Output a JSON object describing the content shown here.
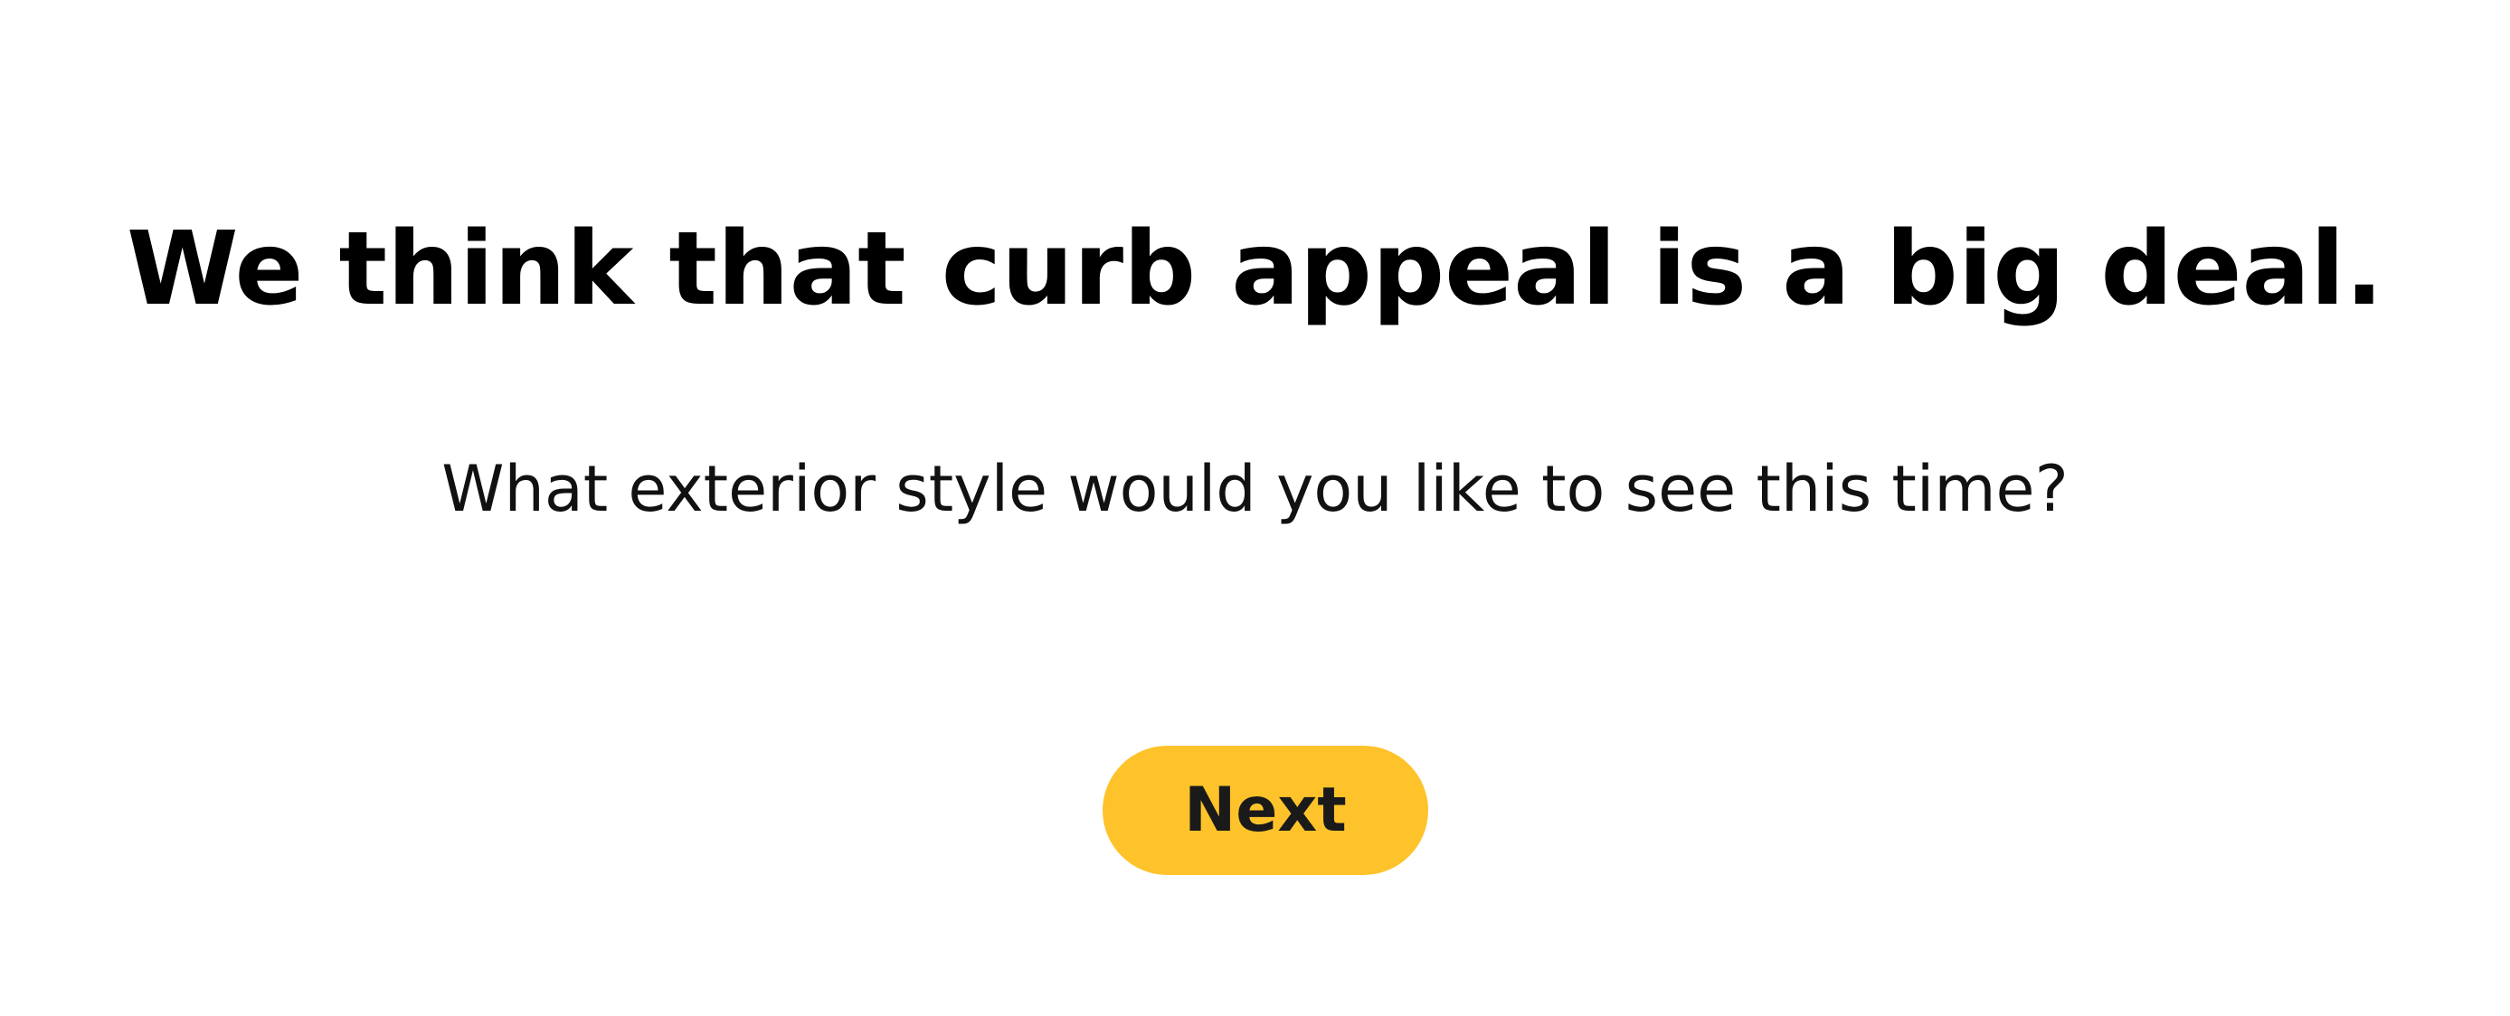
{
  "main": {
    "headline": "We think that curb appeal is a big deal.",
    "subtitle": "What exterior style would you like to see this time?",
    "next_label": "Next"
  },
  "colors": {
    "accent": "#FEC32A",
    "text": "#000000",
    "background": "#FFFFFF"
  }
}
